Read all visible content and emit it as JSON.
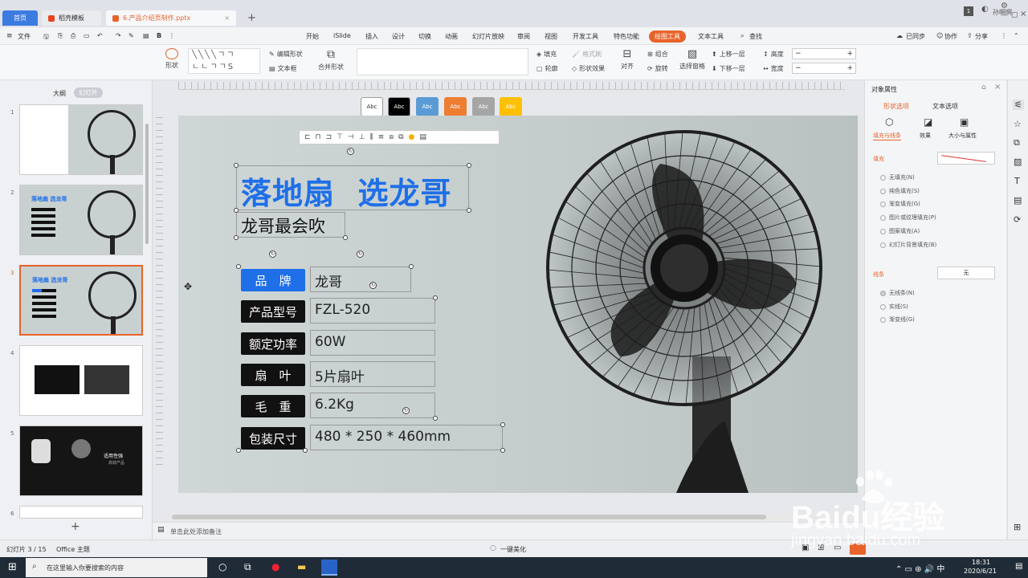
{
  "tabs": {
    "home": "首页",
    "template": "稻壳模板",
    "file": "6.产品介绍页制作.pptx",
    "add": "+"
  },
  "titlebar": {
    "user": "孙啊啊"
  },
  "menu": {
    "file": "文件",
    "items": [
      "开始",
      "iSlide",
      "插入",
      "设计",
      "切换",
      "动画",
      "幻灯片放映",
      "审阅",
      "视图",
      "开发工具",
      "特色功能",
      "绘图工具",
      "文本工具"
    ],
    "search": "查找",
    "right": [
      "已同步",
      "协作",
      "分享"
    ]
  },
  "ribbon": {
    "shape": "形状",
    "edit_shape": "编辑形状",
    "text_box": "文本框",
    "merge_shape": "合并形状",
    "style_label": "Abc",
    "fill": "填充",
    "format_painter": "格式刷",
    "outline": "轮廓",
    "shape_effect": "形状效果",
    "align": "对齐",
    "group": "组合",
    "rotate": "旋转",
    "select_pane": "选择窗格",
    "bring_forward": "上移一层",
    "send_backward": "下移一层",
    "height": "高度",
    "width": "宽度"
  },
  "left": {
    "outline_tab": "大纲",
    "slides_tab": "幻灯片",
    "add": "+"
  },
  "thumbnails": [
    "1",
    "2",
    "3",
    "4",
    "5",
    "6"
  ],
  "thumb_texts": {
    "t2": "落地扇 选龙哥",
    "t5a": "适用性强",
    "t5b": "高效产品"
  },
  "slide": {
    "title": "落地扇  选龙哥",
    "subtitle": "龙哥最会吹",
    "rows": [
      {
        "label": "品　牌",
        "value": "龙哥"
      },
      {
        "label": "产品型号",
        "value": "FZL-520"
      },
      {
        "label": "额定功率",
        "value": "60W"
      },
      {
        "label": "扇　叶",
        "value": "5片扇叶"
      },
      {
        "label": "毛　重",
        "value": "6.2Kg"
      },
      {
        "label": "包装尺寸",
        "value": "480 * 250 * 460mm"
      }
    ]
  },
  "right": {
    "title": "对象属性",
    "tab_shape": "形状选项",
    "tab_text": "文本选项",
    "sub_fill": "填充与线条",
    "sub_effect": "效果",
    "sub_size": "大小与属性",
    "fill": "填充",
    "fill_opts": [
      "无填充(N)",
      "纯色填充(S)",
      "渐变填充(G)",
      "图片或纹理填充(P)",
      "图案填充(A)",
      "幻灯片背景填充(B)"
    ],
    "line": "线条",
    "line_value": "无",
    "line_opts": [
      "无线条(N)",
      "实线(S)",
      "渐变线(G)"
    ]
  },
  "notes": "单击此处添加备注",
  "status": {
    "page": "幻灯片 3 / 15",
    "theme": "Office 主题",
    "beautify": "一键美化"
  },
  "taskbar": {
    "search": "在这里输入你要搜索的内容",
    "time": "18:31",
    "date": "2020/6/21"
  },
  "watermark": {
    "brand": "Baidu经验",
    "url": "jingyan.baidu.com"
  },
  "colors": {
    "accent": "#1e6fe8",
    "ribbon_tab": "#e8632a",
    "dark": "#111111"
  }
}
